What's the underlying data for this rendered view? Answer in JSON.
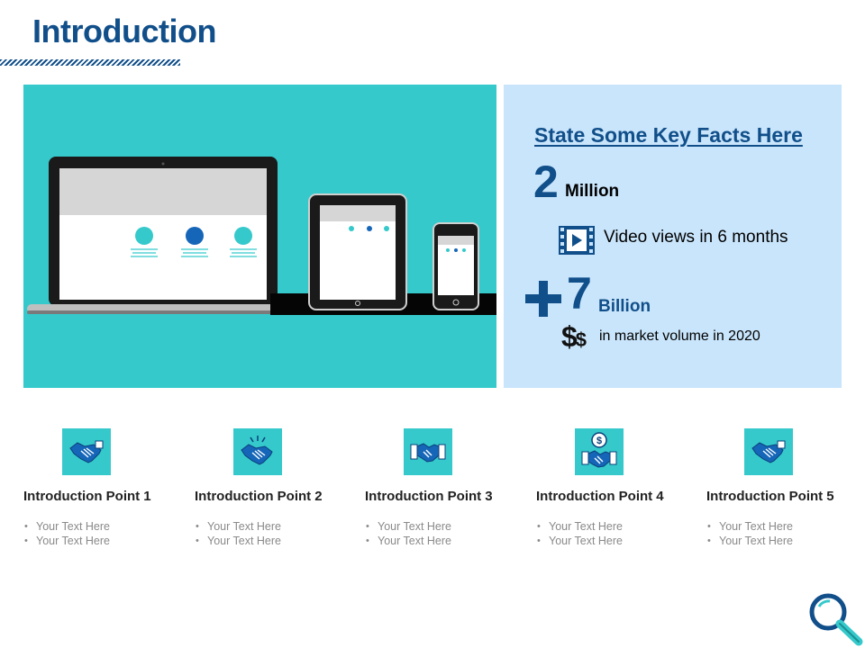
{
  "page": {
    "title": "Introduction"
  },
  "facts": {
    "heading": "State Some Key Facts Here",
    "stat1": {
      "number": "2",
      "unit": "Million",
      "description": "Video views in 6 months",
      "icon": "video-icon"
    },
    "stat2": {
      "prefix_icon": "plus-icon",
      "number": "7",
      "unit": "Billion",
      "currency_icon": "dollar-icon",
      "currency_text": "$$",
      "description": "in market volume  in 2020"
    }
  },
  "points": [
    {
      "title": "Introduction Point 1",
      "icon": "handshake-icon",
      "items": [
        "Your Text Here",
        "Your Text Here"
      ]
    },
    {
      "title": "Introduction Point 2",
      "icon": "handshake-spark-icon",
      "items": [
        "Your Text Here",
        "Your Text Here"
      ]
    },
    {
      "title": "Introduction Point 3",
      "icon": "handshake-icon",
      "items": [
        "Your Text Here",
        "Your Text Here"
      ]
    },
    {
      "title": "Introduction Point 4",
      "icon": "handshake-dollar-icon",
      "items": [
        "Your Text Here",
        "Your Text Here"
      ]
    },
    {
      "title": "Introduction Point 5",
      "icon": "handshake-icon",
      "items": [
        "Your Text Here",
        "Your Text Here"
      ]
    }
  ],
  "colors": {
    "brand": "#114f8a",
    "accent": "#35c9cc",
    "panel": "#c9e5fb"
  }
}
